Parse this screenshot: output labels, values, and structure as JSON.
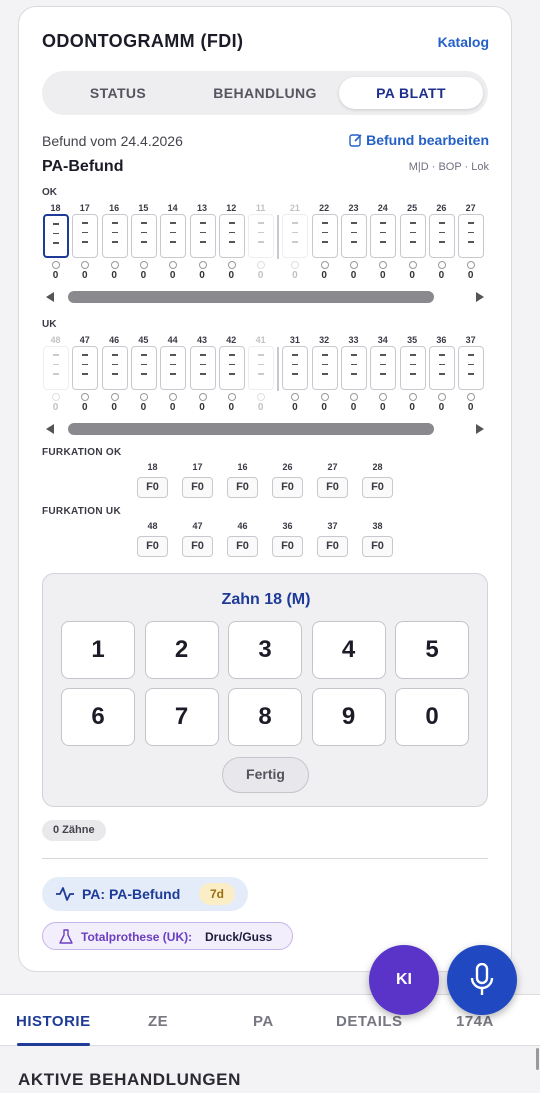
{
  "header": {
    "title": "ODONTOGRAMM (FDI)",
    "catalog_link": "Katalog"
  },
  "tabs_top": [
    {
      "label": "STATUS",
      "active": false
    },
    {
      "label": "BEHANDLUNG",
      "active": false
    },
    {
      "label": "PA BLATT",
      "active": true
    }
  ],
  "befund": {
    "date_text": "Befund vom 24.4.2026",
    "edit_label": "Befund bearbeiten",
    "pa_title": "PA-Befund",
    "legend": "M|D · BOP · Lok"
  },
  "ok": {
    "label": "OK",
    "teeth": [
      {
        "num": "18",
        "state": "selected",
        "value": "0"
      },
      {
        "num": "17",
        "state": "active",
        "value": "0"
      },
      {
        "num": "16",
        "state": "active",
        "value": "0"
      },
      {
        "num": "15",
        "state": "active",
        "value": "0"
      },
      {
        "num": "14",
        "state": "active",
        "value": "0"
      },
      {
        "num": "13",
        "state": "active",
        "value": "0"
      },
      {
        "num": "12",
        "state": "active",
        "value": "0"
      },
      {
        "num": "11",
        "state": "missing",
        "value": "0"
      },
      {
        "num": "21",
        "state": "missing",
        "value": "0"
      },
      {
        "num": "22",
        "state": "active",
        "value": "0"
      },
      {
        "num": "23",
        "state": "active",
        "value": "0"
      },
      {
        "num": "24",
        "state": "active",
        "value": "0"
      },
      {
        "num": "25",
        "state": "active",
        "value": "0"
      },
      {
        "num": "26",
        "state": "active",
        "value": "0"
      },
      {
        "num": "27",
        "state": "active",
        "value": "0"
      }
    ]
  },
  "uk": {
    "label": "UK",
    "teeth": [
      {
        "num": "48",
        "state": "missing",
        "value": "0"
      },
      {
        "num": "47",
        "state": "active",
        "value": "0"
      },
      {
        "num": "46",
        "state": "active",
        "value": "0"
      },
      {
        "num": "45",
        "state": "active",
        "value": "0"
      },
      {
        "num": "44",
        "state": "active",
        "value": "0"
      },
      {
        "num": "43",
        "state": "active",
        "value": "0"
      },
      {
        "num": "42",
        "state": "active",
        "value": "0"
      },
      {
        "num": "41",
        "state": "missing",
        "value": "0"
      },
      {
        "num": "31",
        "state": "active",
        "value": "0"
      },
      {
        "num": "32",
        "state": "active",
        "value": "0"
      },
      {
        "num": "33",
        "state": "active",
        "value": "0"
      },
      {
        "num": "34",
        "state": "active",
        "value": "0"
      },
      {
        "num": "35",
        "state": "active",
        "value": "0"
      },
      {
        "num": "36",
        "state": "active",
        "value": "0"
      },
      {
        "num": "37",
        "state": "active",
        "value": "0"
      }
    ]
  },
  "furkation_ok": {
    "label": "FURKATION OK",
    "items": [
      {
        "num": "18",
        "value": "F0"
      },
      {
        "num": "17",
        "value": "F0"
      },
      {
        "num": "16",
        "value": "F0"
      },
      {
        "num": "26",
        "value": "F0"
      },
      {
        "num": "27",
        "value": "F0"
      },
      {
        "num": "28",
        "value": "F0"
      }
    ]
  },
  "furkation_uk": {
    "label": "FURKATION UK",
    "items": [
      {
        "num": "48",
        "value": "F0"
      },
      {
        "num": "47",
        "value": "F0"
      },
      {
        "num": "46",
        "value": "F0"
      },
      {
        "num": "36",
        "value": "F0"
      },
      {
        "num": "37",
        "value": "F0"
      },
      {
        "num": "38",
        "value": "F0"
      }
    ]
  },
  "keypad": {
    "title": "Zahn 18 (M)",
    "keys": [
      "1",
      "2",
      "3",
      "4",
      "5",
      "6",
      "7",
      "8",
      "9",
      "0"
    ],
    "done_label": "Fertig"
  },
  "count_chip": "0 Zähne",
  "pa_pill": {
    "label": "PA: PA-Befund",
    "days": "7d"
  },
  "prosthesis_pill": {
    "label": "Totalprothese (UK):",
    "value": "Druck/Guss"
  },
  "fab": {
    "ki_label": "KI",
    "mic_icon": "microphone-icon"
  },
  "bottom_tabs": [
    {
      "label": "HISTORIE",
      "active": true
    },
    {
      "label": "ZE",
      "active": false
    },
    {
      "label": "PA",
      "active": false
    },
    {
      "label": "DETAILS",
      "active": false
    },
    {
      "label": "174A",
      "active": false
    }
  ],
  "section_title": "AKTIVE BEHANDLUNGEN",
  "colors": {
    "accent": "#1d3b97",
    "link": "#2460c8",
    "ki": "#5a34c9",
    "mic": "#2048c0",
    "days_badge": "#fbeec6"
  }
}
